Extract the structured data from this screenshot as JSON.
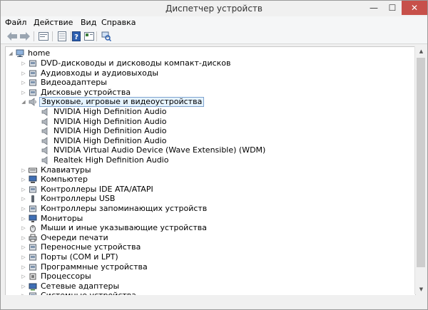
{
  "window": {
    "title": "Диспетчер устройств",
    "controls": {
      "minimize": "—",
      "maximize": "☐",
      "close": "✕"
    }
  },
  "menu": [
    "Файл",
    "Действие",
    "Вид",
    "Справка"
  ],
  "toolbar": [
    "back-icon",
    "forward-icon",
    "properties-icon",
    "sheet-icon",
    "help-icon",
    "view-icon",
    "scan-hardware-icon"
  ],
  "tree": {
    "root": "home",
    "items": [
      {
        "label": "DVD-дисководы и дисководы компакт-дисков",
        "icon": "dvd-drive-icon",
        "expanded": false,
        "level": 1
      },
      {
        "label": "Аудиовходы и аудиовыходы",
        "icon": "audio-io-icon",
        "expanded": false,
        "level": 1
      },
      {
        "label": "Видеоадаптеры",
        "icon": "display-adapter-icon",
        "expanded": false,
        "level": 1
      },
      {
        "label": "Дисковые устройства",
        "icon": "disk-drive-icon",
        "expanded": false,
        "level": 1
      },
      {
        "label": "Звуковые, игровые и видеоустройства",
        "icon": "sound-device-icon",
        "expanded": true,
        "level": 1,
        "selected": true
      },
      {
        "label": "NVIDIA High Definition Audio",
        "icon": "speaker-icon",
        "level": 2
      },
      {
        "label": "NVIDIA High Definition Audio",
        "icon": "speaker-icon",
        "level": 2
      },
      {
        "label": "NVIDIA High Definition Audio",
        "icon": "speaker-icon",
        "level": 2
      },
      {
        "label": "NVIDIA High Definition Audio",
        "icon": "speaker-icon",
        "level": 2
      },
      {
        "label": "NVIDIA Virtual Audio Device (Wave Extensible) (WDM)",
        "icon": "speaker-icon",
        "level": 2
      },
      {
        "label": "Realtek High Definition Audio",
        "icon": "speaker-icon",
        "level": 2
      },
      {
        "label": "Клавиатуры",
        "icon": "keyboard-icon",
        "expanded": false,
        "level": 1
      },
      {
        "label": "Компьютер",
        "icon": "computer-icon",
        "expanded": false,
        "level": 1
      },
      {
        "label": "Контроллеры IDE ATA/ATAPI",
        "icon": "ide-controller-icon",
        "expanded": false,
        "level": 1
      },
      {
        "label": "Контроллеры USB",
        "icon": "usb-icon",
        "expanded": false,
        "level": 1
      },
      {
        "label": "Контроллеры запоминающих устройств",
        "icon": "storage-controller-icon",
        "expanded": false,
        "level": 1
      },
      {
        "label": "Мониторы",
        "icon": "monitor-icon",
        "expanded": false,
        "level": 1
      },
      {
        "label": "Мыши и иные указывающие устройства",
        "icon": "mouse-icon",
        "expanded": false,
        "level": 1
      },
      {
        "label": "Очереди печати",
        "icon": "printer-icon",
        "expanded": false,
        "level": 1
      },
      {
        "label": "Переносные устройства",
        "icon": "portable-device-icon",
        "expanded": false,
        "level": 1
      },
      {
        "label": "Порты (COM и LPT)",
        "icon": "port-icon",
        "expanded": false,
        "level": 1
      },
      {
        "label": "Программные устройства",
        "icon": "software-device-icon",
        "expanded": false,
        "level": 1
      },
      {
        "label": "Процессоры",
        "icon": "processor-icon",
        "expanded": false,
        "level": 1
      },
      {
        "label": "Сетевые адаптеры",
        "icon": "network-adapter-icon",
        "expanded": false,
        "level": 1
      },
      {
        "label": "Системные устройства",
        "icon": "system-device-icon",
        "expanded": false,
        "level": 1
      }
    ]
  },
  "scrollbar": {
    "up": "▲",
    "down": "▼"
  },
  "colors": {
    "selection_bg": "#e5f3ff",
    "selection_border": "#7da2ce",
    "close_button": "#c7504a"
  }
}
